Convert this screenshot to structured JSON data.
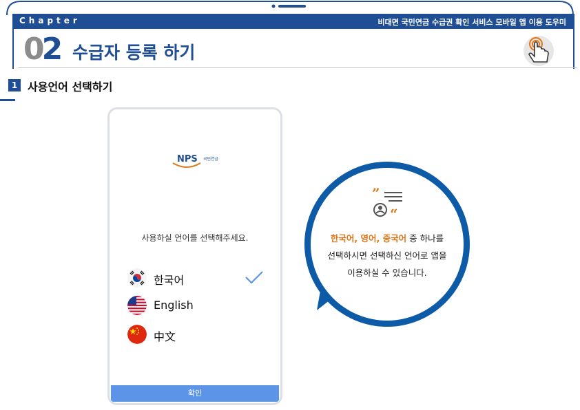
{
  "header": {
    "chapter_label": "Chapter",
    "doc_title": "비대면 국민연금 수급권 확인 서비스 모바일 앱 이용 도우미",
    "chapter_number_first": "0",
    "chapter_number_second": "2",
    "chapter_title": "수급자 등록 하기"
  },
  "section": {
    "number": "1",
    "title": "사용언어 선택하기"
  },
  "phone": {
    "logo_text": "NPS",
    "logo_subtext": "국민연금",
    "prompt": "사용하실 언어를 선택해주세요.",
    "languages": [
      {
        "label": "한국어",
        "icon": "korea-flag-icon",
        "selected": true
      },
      {
        "label": "English",
        "icon": "usa-flag-icon",
        "selected": false
      },
      {
        "label": "中文",
        "icon": "china-flag-icon",
        "selected": false
      }
    ],
    "confirm_label": "확인"
  },
  "callout": {
    "highlight": "한국어, 영어, 중국어",
    "line1_rest": " 중 하나를",
    "line2": "선택하시면 선택하신 언어로 앱을",
    "line3": "이용하실 수 있습니다."
  },
  "colors": {
    "brand_blue": "#1f4e95",
    "callout_blue": "#0d5aa7",
    "accent_orange": "#e0771a",
    "button_blue": "#5c95e8"
  }
}
